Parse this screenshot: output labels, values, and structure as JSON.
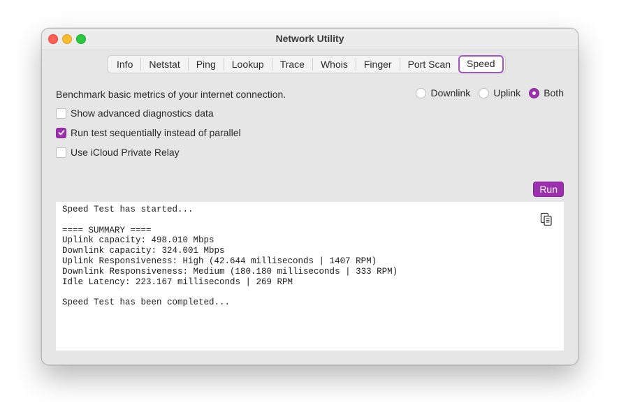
{
  "window": {
    "title": "Network Utility"
  },
  "tabs": [
    "Info",
    "Netstat",
    "Ping",
    "Lookup",
    "Trace",
    "Whois",
    "Finger",
    "Port Scan",
    "Speed"
  ],
  "active_tab": "Speed",
  "description": "Benchmark basic metrics of your internet connection.",
  "radio_options": [
    {
      "label": "Downlink",
      "selected": false
    },
    {
      "label": "Uplink",
      "selected": false
    },
    {
      "label": "Both",
      "selected": true
    }
  ],
  "checkboxes": [
    {
      "label": "Show advanced diagnostics data",
      "checked": false
    },
    {
      "label": "Run test sequentially instead of parallel",
      "checked": true
    },
    {
      "label": "Use iCloud Private Relay",
      "checked": false
    }
  ],
  "run_label": "Run",
  "output_lines": [
    "Speed Test has started...",
    "",
    "==== SUMMARY ====",
    "Uplink capacity: 498.010 Mbps",
    "Downlink capacity: 324.001 Mbps",
    "Uplink Responsiveness: High (42.644 milliseconds | 1407 RPM)",
    "Downlink Responsiveness: Medium (180.180 milliseconds | 333 RPM)",
    "Idle Latency: 223.167 milliseconds | 269 RPM",
    "",
    "Speed Test has been completed..."
  ],
  "accent_color": "#9b2fae",
  "copy_icon": "copy-icon"
}
